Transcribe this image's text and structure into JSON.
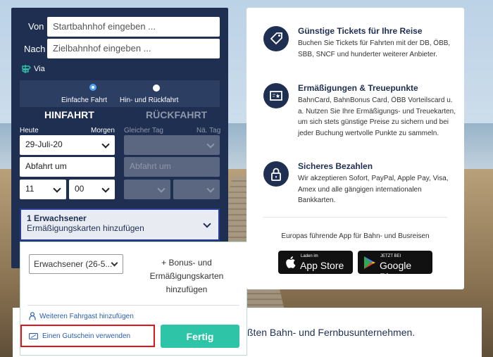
{
  "search": {
    "from_label": "Von",
    "from_placeholder": "Startbahnhof eingeben ...",
    "to_label": "Nach",
    "to_placeholder": "Zielbahnhof eingeben ...",
    "via_label": "Via",
    "trip_types": [
      "Einfache Fahrt",
      "Hin- und Rückfahrt"
    ],
    "outbound": {
      "title": "HINFAHRT",
      "today": "Heute",
      "tomorrow": "Morgen",
      "date": "29-Juli-20",
      "mode": "Abfahrt um",
      "hour": "11",
      "minute": "00"
    },
    "return": {
      "title": "RÜCKFAHRT",
      "same_day": "Gleicher Tag",
      "next_day": "Nä. Tag",
      "mode": "Abfahrt um"
    },
    "passengers": {
      "title": "1 Erwachsener",
      "subtitle": "Ermäßigungskarten hinzufügen"
    }
  },
  "pax_panel": {
    "type_value": "Erwachsener (26-5...",
    "bonus_text": "+ Bonus- und Ermäßigungskarten hinzufügen",
    "add_passenger": "Weiteren Fahrgast hinzufügen",
    "voucher": "Einen Gutschein verwenden",
    "done": "Fertig"
  },
  "info": {
    "features": [
      {
        "icon": "ticket-tag-icon",
        "title": "Günstige Tickets für Ihre Reise",
        "text": "Buchen Sie Tickets für Fahrten mit der DB, ÖBB, SBB, SNCF und hunderter weiterer Anbieter."
      },
      {
        "icon": "discount-card-icon",
        "title": "Ermäßigungen & Treuepunkte",
        "text": "BahnCard, BahnBonus Card, ÖBB Vorteilscard u. a. Nutzen Sie Ihre Ermäßigungs- und Treuekarten, um sich stets günstige Preise zu sichern und bei jeder Buchung wertvolle Punkte zu sammeln."
      },
      {
        "icon": "lock-icon",
        "title": "Sicheres Bezahlen",
        "text": "Wir akzeptieren Sofort, PayPal, Apple Pay, Visa, Amex und alle gängigen internationalen Bankkarten."
      }
    ],
    "app_caption": "Europas führende App für Bahn- und Busreisen",
    "app_store_small": "Laden im",
    "app_store_large": "App Store",
    "google_small": "JETZT BEI",
    "google_large": "Google Play"
  },
  "bottom_text": "ßten Bahn- und Fernbusunternehmen."
}
